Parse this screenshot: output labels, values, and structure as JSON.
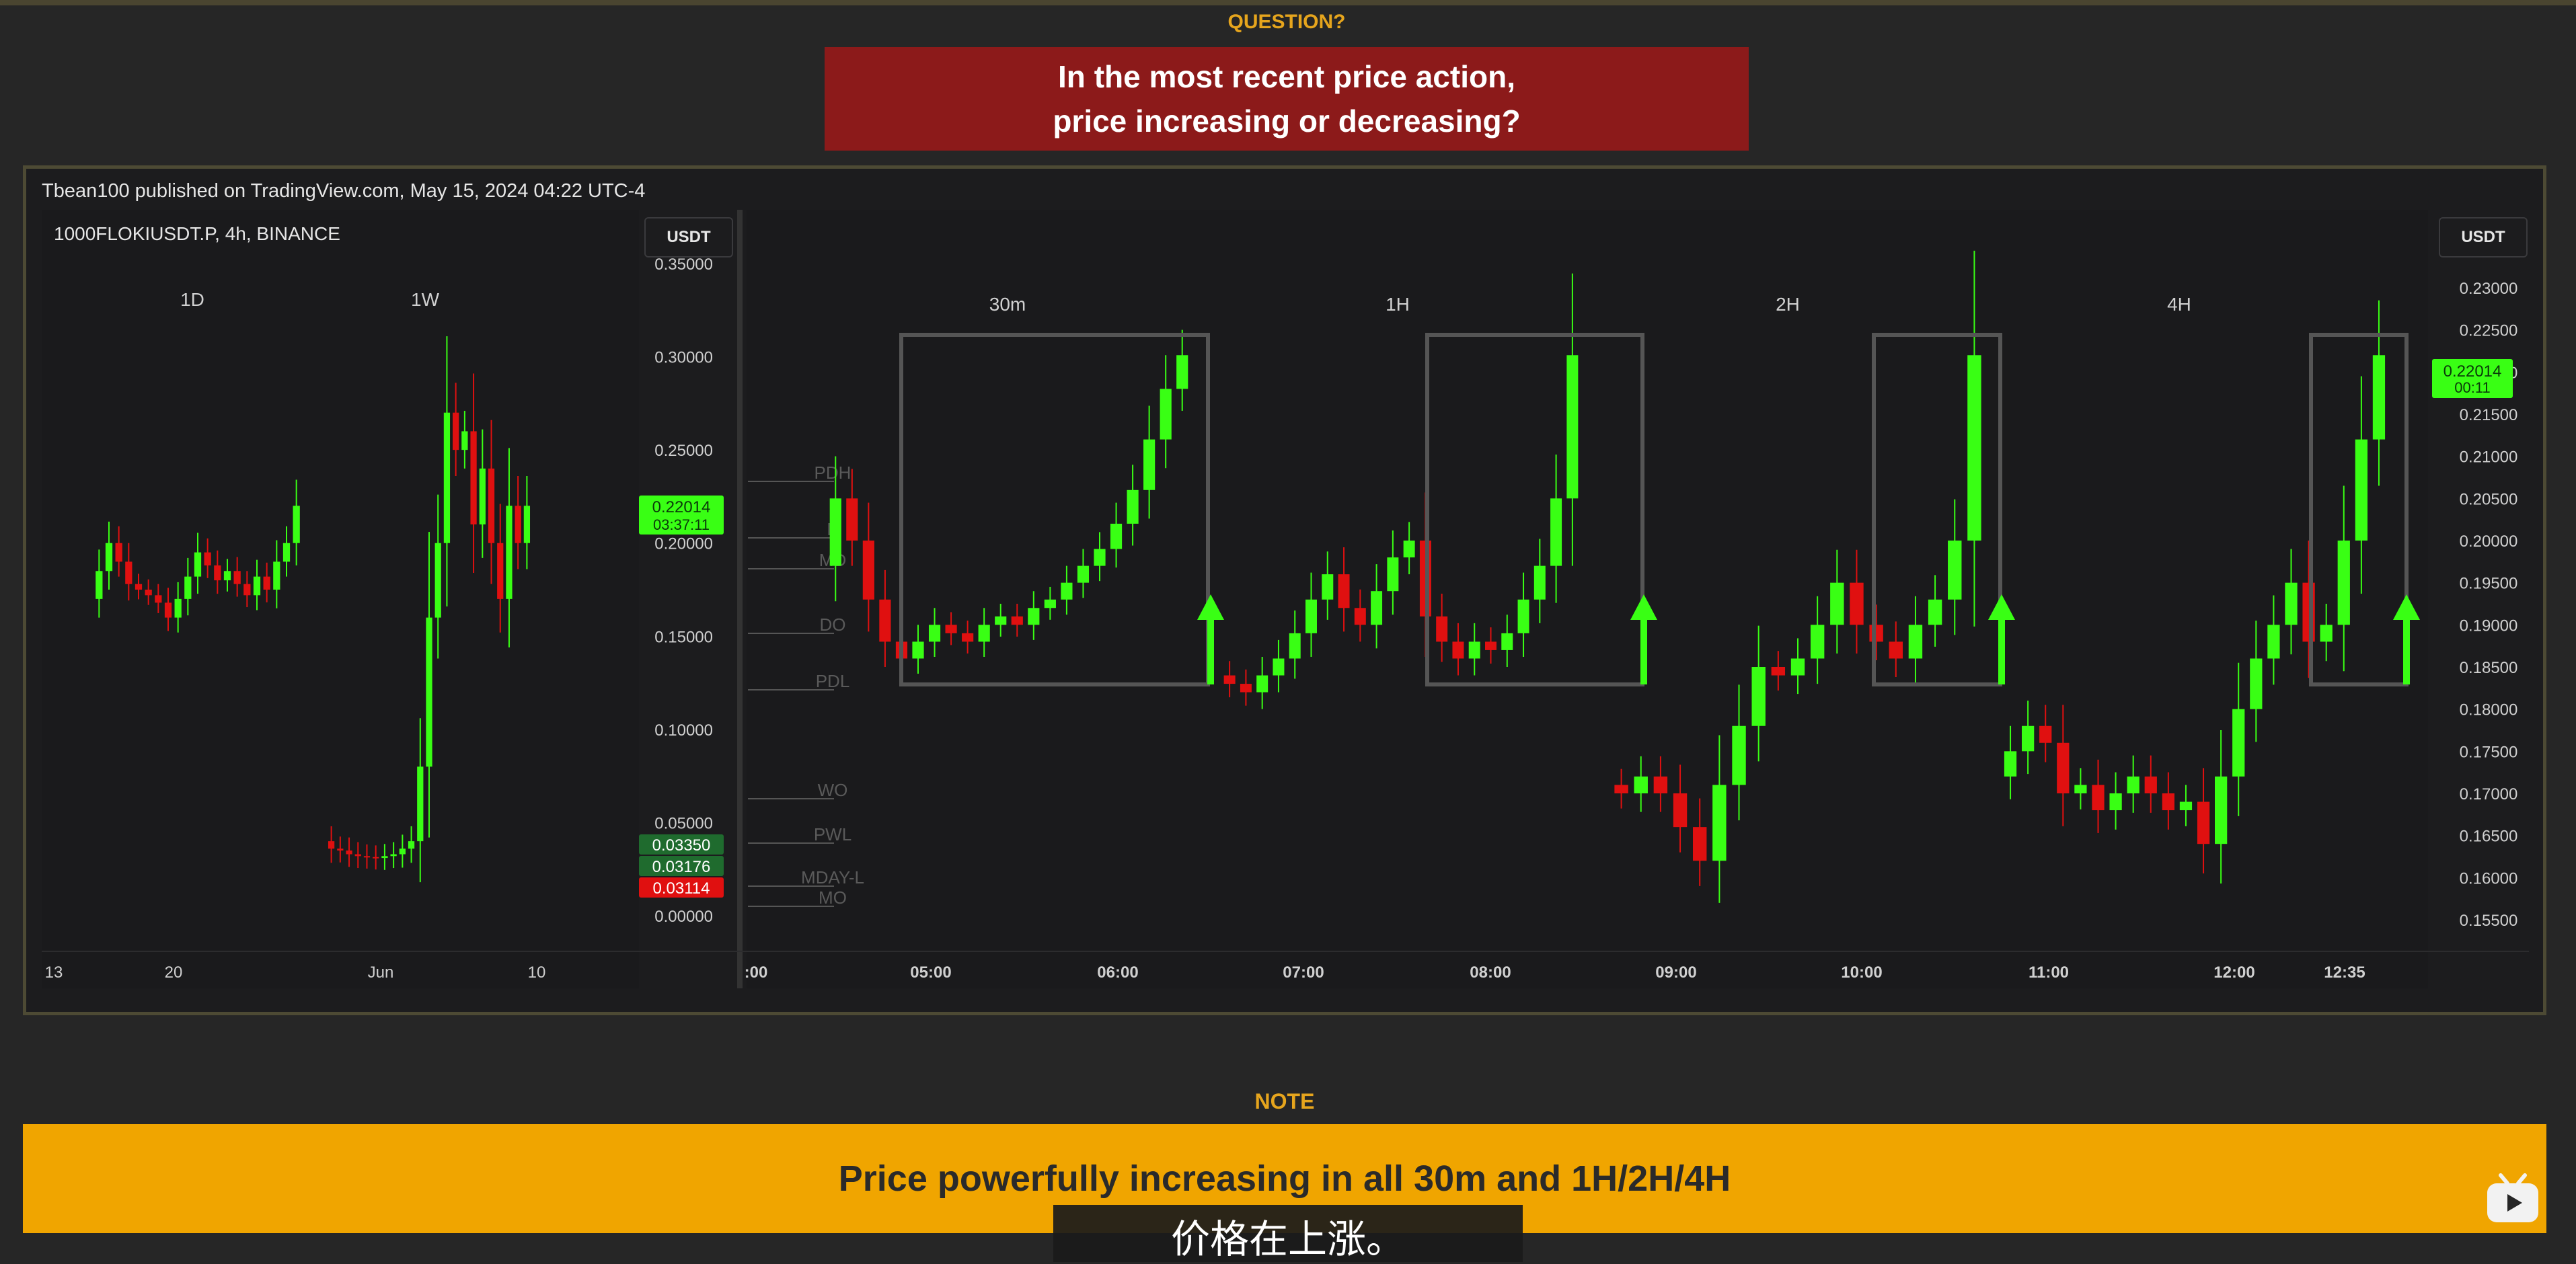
{
  "header": {
    "question_label": "QUESTION?",
    "question_line1": "In the most recent price action,",
    "question_line2": "price increasing or decreasing?"
  },
  "chart_panel": {
    "publisher": "Tbean100 published on TradingView.com, May 15, 2024 04:22 UTC-4",
    "symbol": "1000FLOKIUSDT.P, 4h, BINANCE",
    "currency_button_left": "USDT",
    "currency_button_right": "USDT"
  },
  "chart_data": [
    {
      "type": "candlestick",
      "title": "",
      "timeframe_labels": [
        "1D",
        "1W"
      ],
      "xticks": [
        "13",
        "20",
        "Jun",
        "10"
      ],
      "yticks": [
        "0.35000",
        "0.30000",
        "0.25000",
        "0.20000",
        "0.15000",
        "0.10000",
        "0.05000",
        "0.00000"
      ],
      "ylim": [
        0,
        0.35
      ],
      "price_tags": [
        {
          "text": "0.22014",
          "sub": "03:37:11",
          "value": 0.22014,
          "color": "#39ff14"
        },
        {
          "text": "0.03350",
          "value": 0.0335,
          "color": "#1f6b2e"
        },
        {
          "text": "0.03176",
          "value": 0.03176,
          "color": "#1f6b2e"
        },
        {
          "text": "0.03114",
          "value": 0.03114,
          "color": "#e01010"
        }
      ]
    },
    {
      "type": "candlestick",
      "title": "",
      "timeframe_labels": [
        "30m",
        "1H",
        "2H",
        "4H"
      ],
      "level_labels": [
        "PDH",
        "P",
        "MD",
        "DO",
        "PDL",
        "WO",
        "PWL",
        "MDAY-L",
        "MO"
      ],
      "xticks": [
        ":00",
        "05:00",
        "06:00",
        "07:00",
        "08:00",
        "09:00",
        "10:00",
        "11:00",
        "12:00",
        "12:35"
      ],
      "yticks": [
        "0.23000",
        "0.22500",
        "0.22000",
        "0.21500",
        "0.21000",
        "0.20500",
        "0.20000",
        "0.19500",
        "0.19000",
        "0.18500",
        "0.18000",
        "0.17500",
        "0.17000",
        "0.16500",
        "0.16000",
        "0.15500"
      ],
      "ylim": [
        0.153,
        0.232
      ],
      "price_tags": [
        {
          "text": "0.22014",
          "sub": "00:11",
          "value": 0.22014,
          "color": "#39ff14"
        }
      ],
      "trend": "up"
    }
  ],
  "note": {
    "label": "NOTE",
    "text": "Price powerfully increasing in all 30m and 1H/2H/4H"
  },
  "subtitle": "价格在上涨。",
  "colors": {
    "up": "#39ff14",
    "down": "#e01010",
    "question_bg": "#8c1a1a",
    "note_bg": "#f0a500",
    "accent": "#e6a51d"
  }
}
